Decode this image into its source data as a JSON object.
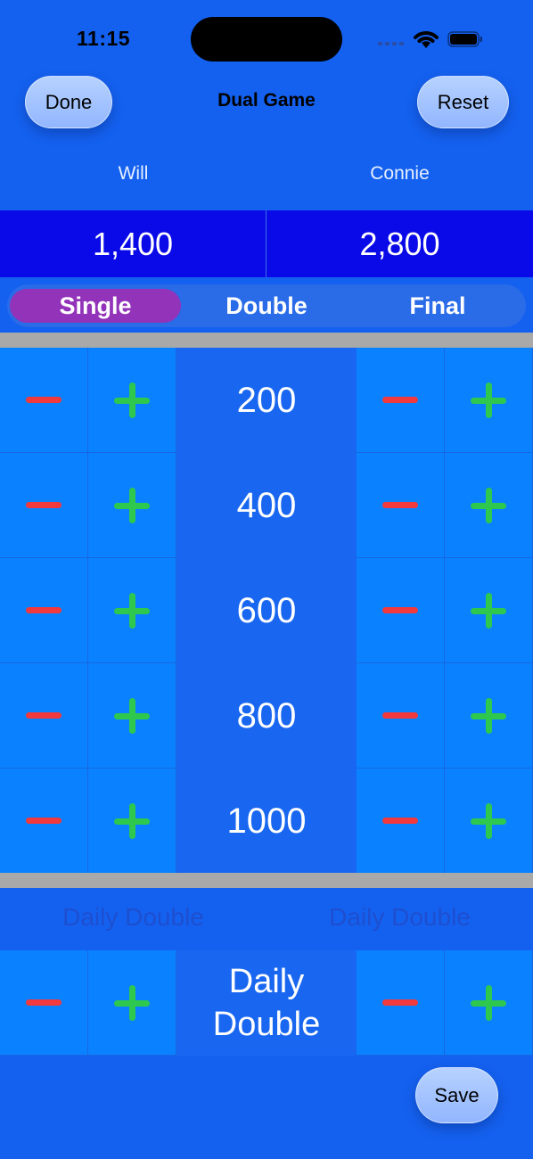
{
  "status_bar": {
    "time": "11:15"
  },
  "header": {
    "title": "Dual Game",
    "done_label": "Done",
    "reset_label": "Reset"
  },
  "players": [
    {
      "name": "Will",
      "score": "1,400"
    },
    {
      "name": "Connie",
      "score": "2,800"
    }
  ],
  "rounds": {
    "tabs": [
      "Single",
      "Double",
      "Final"
    ],
    "selected": "Single"
  },
  "clue_values": [
    "200",
    "400",
    "600",
    "800",
    "1000"
  ],
  "daily_double": {
    "left_label": "Daily Double",
    "right_label": "Daily Double",
    "center_line1": "Daily",
    "center_line2": "Double"
  },
  "footer": {
    "save_label": "Save"
  },
  "colors": {
    "background": "#1461f0",
    "score_box": "#0a0ae8",
    "cell": "#0a82ff",
    "selected_tab": "#9233b9",
    "minus": "#f2393d",
    "plus": "#2ec84f"
  }
}
